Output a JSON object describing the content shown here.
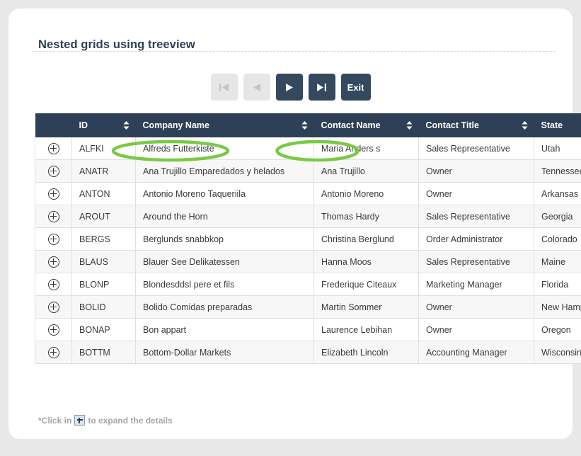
{
  "page": {
    "title": "Nested grids using treeview",
    "footnote_prefix": "*Click in",
    "footnote_suffix": "to expand the details",
    "accent_dark": "#2e4057",
    "button_dark": "#34495e",
    "highlight_green": "#7ac943",
    "background": "#e8e8e8"
  },
  "pager": {
    "buttons": [
      {
        "name": "first-page-button",
        "icon": "first-page-icon",
        "label": "",
        "state": "disabled"
      },
      {
        "name": "previous-page-button",
        "icon": "previous-page-icon",
        "label": "",
        "state": "disabled"
      },
      {
        "name": "next-page-button",
        "icon": "next-page-icon",
        "label": "",
        "state": "enabled"
      },
      {
        "name": "last-page-button",
        "icon": "last-page-icon",
        "label": "",
        "state": "enabled"
      },
      {
        "name": "exit-button",
        "icon": "",
        "label": "Exit",
        "state": "enabled"
      }
    ]
  },
  "grid": {
    "columns": [
      {
        "key": "expander",
        "label": "",
        "sortable": false
      },
      {
        "key": "id",
        "label": "ID",
        "sortable": true
      },
      {
        "key": "company",
        "label": "Company Name",
        "sortable": true
      },
      {
        "key": "contact",
        "label": "Contact Name",
        "sortable": true
      },
      {
        "key": "title",
        "label": "Contact Title",
        "sortable": true
      },
      {
        "key": "state",
        "label": "State",
        "sortable": false
      }
    ],
    "rows": [
      {
        "id": "ALFKI",
        "company": "Alfreds Futterkiste",
        "contact": "Maria Anders s",
        "title": "Sales Representative",
        "state": "Utah"
      },
      {
        "id": "ANATR",
        "company": "Ana Trujillo Emparedados y helados",
        "contact": "Ana Trujillo",
        "title": "Owner",
        "state": "Tennessee"
      },
      {
        "id": "ANTON",
        "company": "Antonio Moreno Taqueriila",
        "contact": "Antonio Moreno",
        "title": "Owner",
        "state": "Arkansas"
      },
      {
        "id": "AROUT",
        "company": "Around the Horn",
        "contact": "Thomas Hardy",
        "title": "Sales Representative",
        "state": "Georgia"
      },
      {
        "id": "BERGS",
        "company": "Berglunds snabbkop",
        "contact": "Christina Berglund",
        "title": "Order Administrator",
        "state": "Colorado"
      },
      {
        "id": "BLAUS",
        "company": "Blauer See Delikatessen",
        "contact": "Hanna Moos",
        "title": "Sales Representative",
        "state": "Maine"
      },
      {
        "id": "BLONP",
        "company": "Blondesddsl pere et fils",
        "contact": "Frederique Citeaux",
        "title": "Marketing Manager",
        "state": "Florida"
      },
      {
        "id": "BOLID",
        "company": "Bolido Comidas preparadas",
        "contact": "Martin Sommer",
        "title": "Owner",
        "state": "New Hampshire"
      },
      {
        "id": "BONAP",
        "company": "Bon appart",
        "contact": "Laurence Lebihan",
        "title": "Owner",
        "state": "Oregon"
      },
      {
        "id": "BOTTM",
        "company": "Bottom-Dollar Markets",
        "contact": "Elizabeth Lincoln",
        "title": "Accounting Manager",
        "state": "Wisconsin"
      }
    ]
  },
  "annotations": [
    {
      "name": "highlight-company-alfki",
      "target": "Alfreds Futterkiste"
    },
    {
      "name": "highlight-contact-alfki",
      "target": "Maria Anders s"
    }
  ]
}
